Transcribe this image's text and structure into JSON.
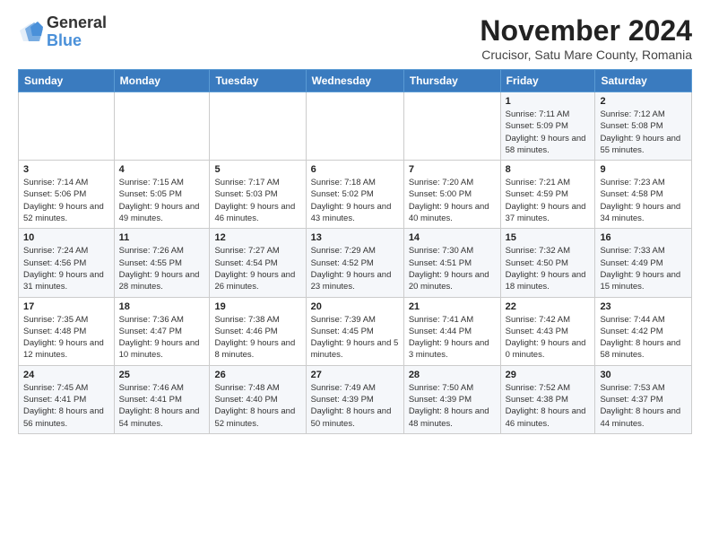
{
  "logo": {
    "line1": "General",
    "line2": "Blue"
  },
  "title": "November 2024",
  "location": "Crucisor, Satu Mare County, Romania",
  "days_of_week": [
    "Sunday",
    "Monday",
    "Tuesday",
    "Wednesday",
    "Thursday",
    "Friday",
    "Saturday"
  ],
  "weeks": [
    [
      {
        "day": "",
        "info": ""
      },
      {
        "day": "",
        "info": ""
      },
      {
        "day": "",
        "info": ""
      },
      {
        "day": "",
        "info": ""
      },
      {
        "day": "",
        "info": ""
      },
      {
        "day": "1",
        "info": "Sunrise: 7:11 AM\nSunset: 5:09 PM\nDaylight: 9 hours and 58 minutes."
      },
      {
        "day": "2",
        "info": "Sunrise: 7:12 AM\nSunset: 5:08 PM\nDaylight: 9 hours and 55 minutes."
      }
    ],
    [
      {
        "day": "3",
        "info": "Sunrise: 7:14 AM\nSunset: 5:06 PM\nDaylight: 9 hours and 52 minutes."
      },
      {
        "day": "4",
        "info": "Sunrise: 7:15 AM\nSunset: 5:05 PM\nDaylight: 9 hours and 49 minutes."
      },
      {
        "day": "5",
        "info": "Sunrise: 7:17 AM\nSunset: 5:03 PM\nDaylight: 9 hours and 46 minutes."
      },
      {
        "day": "6",
        "info": "Sunrise: 7:18 AM\nSunset: 5:02 PM\nDaylight: 9 hours and 43 minutes."
      },
      {
        "day": "7",
        "info": "Sunrise: 7:20 AM\nSunset: 5:00 PM\nDaylight: 9 hours and 40 minutes."
      },
      {
        "day": "8",
        "info": "Sunrise: 7:21 AM\nSunset: 4:59 PM\nDaylight: 9 hours and 37 minutes."
      },
      {
        "day": "9",
        "info": "Sunrise: 7:23 AM\nSunset: 4:58 PM\nDaylight: 9 hours and 34 minutes."
      }
    ],
    [
      {
        "day": "10",
        "info": "Sunrise: 7:24 AM\nSunset: 4:56 PM\nDaylight: 9 hours and 31 minutes."
      },
      {
        "day": "11",
        "info": "Sunrise: 7:26 AM\nSunset: 4:55 PM\nDaylight: 9 hours and 28 minutes."
      },
      {
        "day": "12",
        "info": "Sunrise: 7:27 AM\nSunset: 4:54 PM\nDaylight: 9 hours and 26 minutes."
      },
      {
        "day": "13",
        "info": "Sunrise: 7:29 AM\nSunset: 4:52 PM\nDaylight: 9 hours and 23 minutes."
      },
      {
        "day": "14",
        "info": "Sunrise: 7:30 AM\nSunset: 4:51 PM\nDaylight: 9 hours and 20 minutes."
      },
      {
        "day": "15",
        "info": "Sunrise: 7:32 AM\nSunset: 4:50 PM\nDaylight: 9 hours and 18 minutes."
      },
      {
        "day": "16",
        "info": "Sunrise: 7:33 AM\nSunset: 4:49 PM\nDaylight: 9 hours and 15 minutes."
      }
    ],
    [
      {
        "day": "17",
        "info": "Sunrise: 7:35 AM\nSunset: 4:48 PM\nDaylight: 9 hours and 12 minutes."
      },
      {
        "day": "18",
        "info": "Sunrise: 7:36 AM\nSunset: 4:47 PM\nDaylight: 9 hours and 10 minutes."
      },
      {
        "day": "19",
        "info": "Sunrise: 7:38 AM\nSunset: 4:46 PM\nDaylight: 9 hours and 8 minutes."
      },
      {
        "day": "20",
        "info": "Sunrise: 7:39 AM\nSunset: 4:45 PM\nDaylight: 9 hours and 5 minutes."
      },
      {
        "day": "21",
        "info": "Sunrise: 7:41 AM\nSunset: 4:44 PM\nDaylight: 9 hours and 3 minutes."
      },
      {
        "day": "22",
        "info": "Sunrise: 7:42 AM\nSunset: 4:43 PM\nDaylight: 9 hours and 0 minutes."
      },
      {
        "day": "23",
        "info": "Sunrise: 7:44 AM\nSunset: 4:42 PM\nDaylight: 8 hours and 58 minutes."
      }
    ],
    [
      {
        "day": "24",
        "info": "Sunrise: 7:45 AM\nSunset: 4:41 PM\nDaylight: 8 hours and 56 minutes."
      },
      {
        "day": "25",
        "info": "Sunrise: 7:46 AM\nSunset: 4:41 PM\nDaylight: 8 hours and 54 minutes."
      },
      {
        "day": "26",
        "info": "Sunrise: 7:48 AM\nSunset: 4:40 PM\nDaylight: 8 hours and 52 minutes."
      },
      {
        "day": "27",
        "info": "Sunrise: 7:49 AM\nSunset: 4:39 PM\nDaylight: 8 hours and 50 minutes."
      },
      {
        "day": "28",
        "info": "Sunrise: 7:50 AM\nSunset: 4:39 PM\nDaylight: 8 hours and 48 minutes."
      },
      {
        "day": "29",
        "info": "Sunrise: 7:52 AM\nSunset: 4:38 PM\nDaylight: 8 hours and 46 minutes."
      },
      {
        "day": "30",
        "info": "Sunrise: 7:53 AM\nSunset: 4:37 PM\nDaylight: 8 hours and 44 minutes."
      }
    ]
  ]
}
